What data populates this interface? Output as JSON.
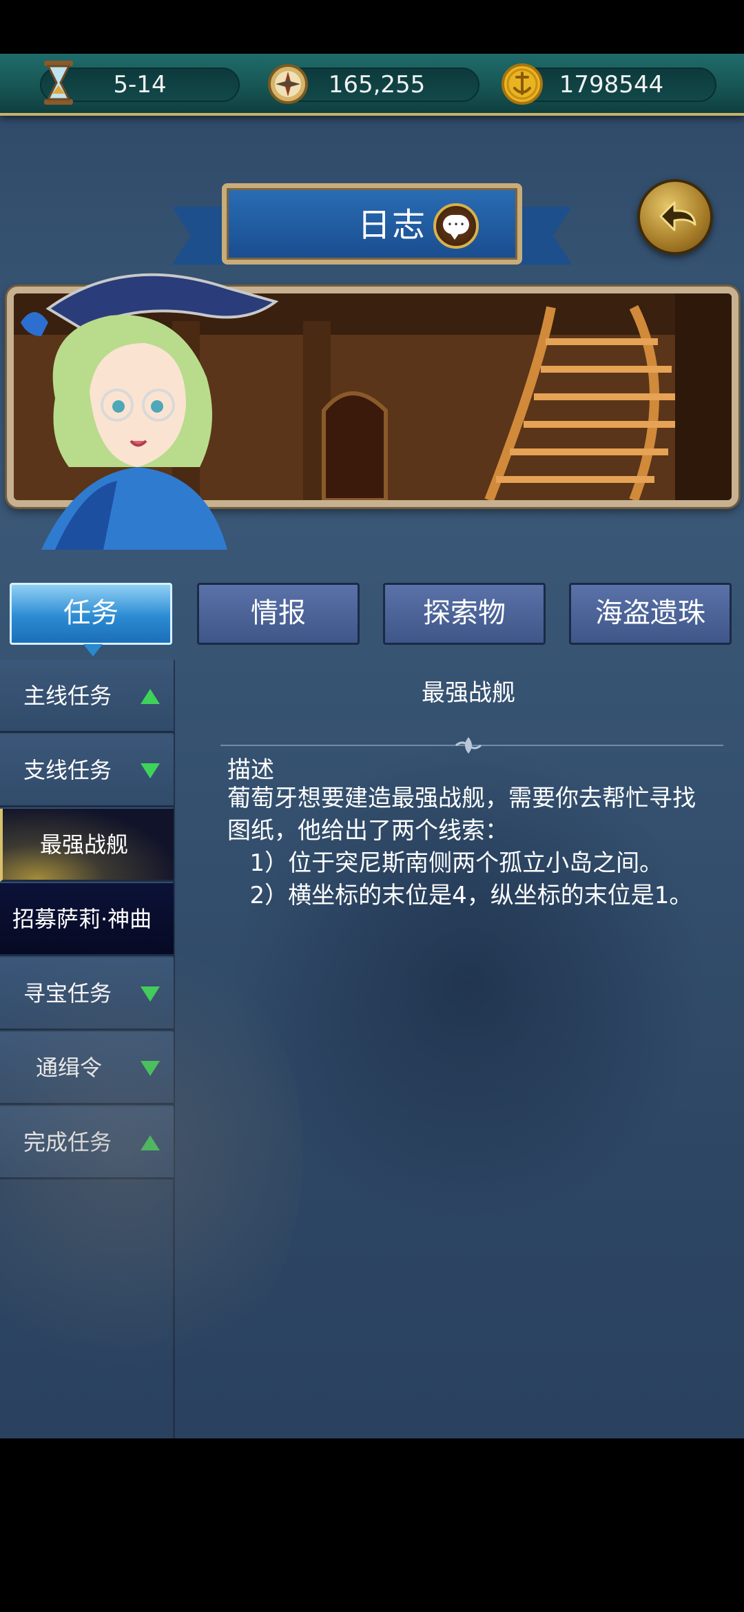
{
  "resources": {
    "timer": "5-14",
    "compass": "165,255",
    "gold": "1798544"
  },
  "header": {
    "title": "日志"
  },
  "tabs": [
    "任务",
    "情报",
    "探索物",
    "海盗遗珠"
  ],
  "sidebar": {
    "items": [
      {
        "label": "主线任务",
        "arrow": "up"
      },
      {
        "label": "支线任务",
        "arrow": "down"
      },
      {
        "label": "最强战舰"
      },
      {
        "label": "招募萨莉·神曲"
      },
      {
        "label": "寻宝任务",
        "arrow": "down"
      },
      {
        "label": "通缉令",
        "arrow": "down"
      },
      {
        "label": "完成任务",
        "arrow": "up"
      }
    ]
  },
  "quest": {
    "title": "最强战舰",
    "desc_label": "描述",
    "description": "葡萄牙想要建造最强战舰，需要你去帮忙寻找图纸，他给出了两个线索：\n   1）位于突尼斯南侧两个孤立小岛之间。\n   2）横坐标的末位是4，纵坐标的末位是1。"
  },
  "colors": {
    "accent_green": "#3fd25b",
    "tab_active": "#2c8bd3",
    "frame_gold": "#c8ad7a"
  }
}
